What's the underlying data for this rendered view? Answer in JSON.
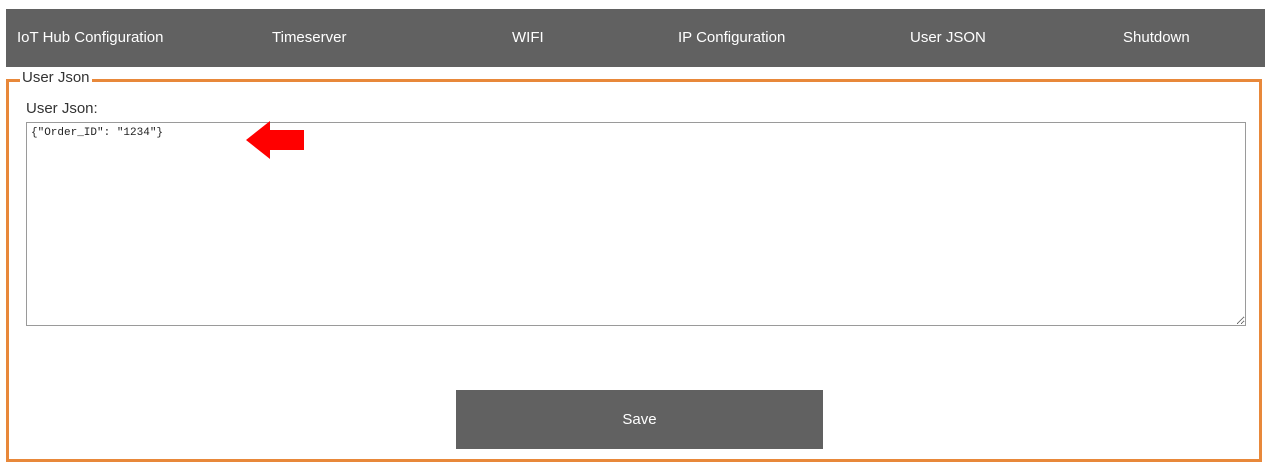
{
  "nav": {
    "items": [
      {
        "label": "IoT Hub Configuration"
      },
      {
        "label": "Timeserver"
      },
      {
        "label": "WIFI"
      },
      {
        "label": "IP Configuration"
      },
      {
        "label": "User JSON"
      },
      {
        "label": "Shutdown"
      }
    ]
  },
  "panel": {
    "legend": "User Json",
    "field_label": "User Json:",
    "json_value": "{\"Order_ID\": \"1234\"}",
    "save_label": "Save"
  },
  "annotation": {
    "arrow_icon": "left-arrow-icon",
    "arrow_color": "#ff0000"
  },
  "colors": {
    "navbar": "#616161",
    "panel_border": "#e8883a",
    "button": "#616161"
  }
}
